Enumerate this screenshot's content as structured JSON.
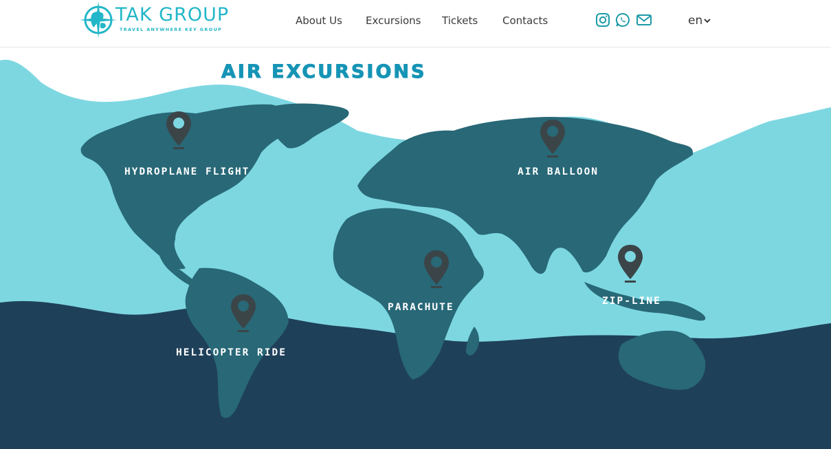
{
  "brand": {
    "name": "TAK GROUP",
    "tagline": "TRAVEL ANYWHERE KEY GROUP"
  },
  "nav": {
    "items": [
      {
        "label": "About Us"
      },
      {
        "label": "Excursions"
      },
      {
        "label": "Tickets"
      },
      {
        "label": "Contacts"
      }
    ]
  },
  "social": {
    "icons": [
      "instagram-icon",
      "whatsapp-icon",
      "mail-icon"
    ]
  },
  "language": {
    "current": "en"
  },
  "hero": {
    "title": "AIR EXCURSIONS"
  },
  "destinations": [
    {
      "label": "HYDROPLANE FLIGHT"
    },
    {
      "label": "AIR BALLOON"
    },
    {
      "label": "PARACHUTE"
    },
    {
      "label": "ZIP-LINE"
    },
    {
      "label": "HELICOPTER RIDE"
    }
  ],
  "colors": {
    "brand": "#22b6c8",
    "title": "#1694b5",
    "sea": "#7dd7e1",
    "ocean_dark": "#1f4059",
    "land": "#286877",
    "pin": "#3b4548"
  }
}
